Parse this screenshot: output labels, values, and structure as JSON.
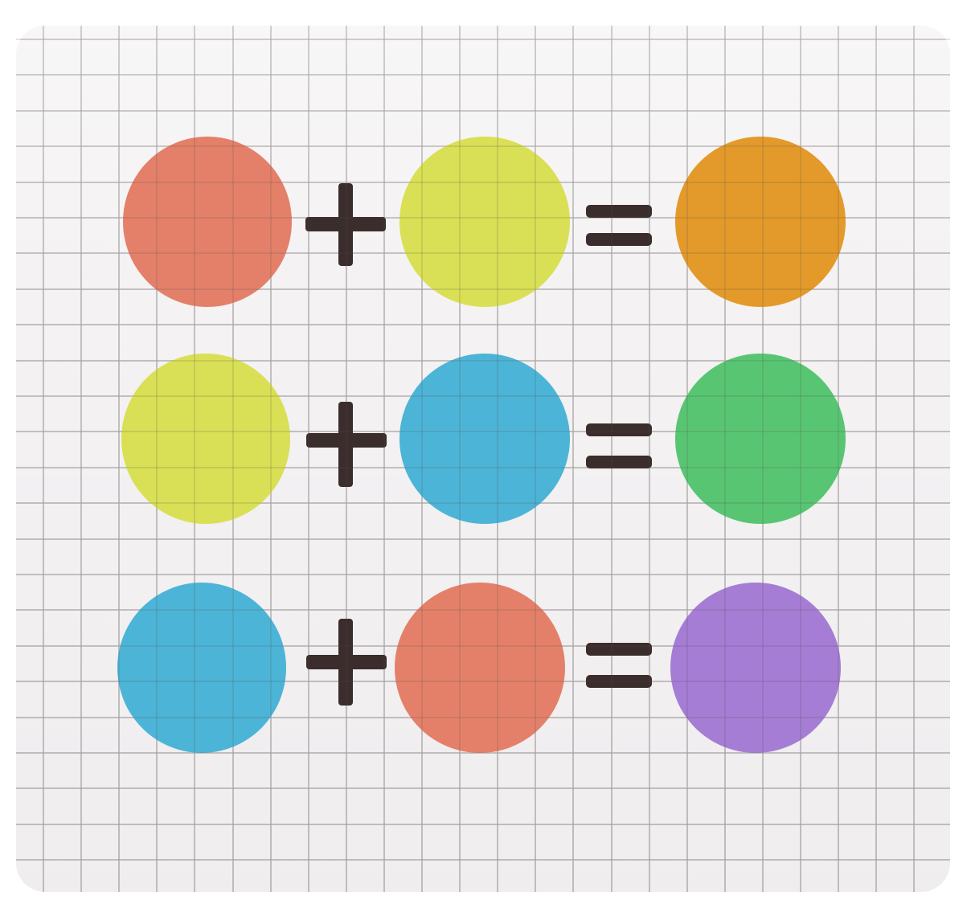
{
  "equations": [
    {
      "left": {
        "name": "red",
        "color": "#e48069"
      },
      "right": {
        "name": "yellow",
        "color": "#d9e055"
      },
      "result": {
        "name": "orange",
        "color": "#e39a2a"
      }
    },
    {
      "left": {
        "name": "yellow",
        "color": "#d9e055"
      },
      "right": {
        "name": "blue",
        "color": "#4cb4d7"
      },
      "result": {
        "name": "green",
        "color": "#58c573"
      }
    },
    {
      "left": {
        "name": "blue",
        "color": "#4cb4d7"
      },
      "right": {
        "name": "red",
        "color": "#e48069"
      },
      "result": {
        "name": "purple",
        "color": "#a57dd4"
      }
    }
  ],
  "colors": {
    "paper": "#f4f2f3",
    "grid_line": "#d7d5d6",
    "ink": "#3a2d2c"
  }
}
